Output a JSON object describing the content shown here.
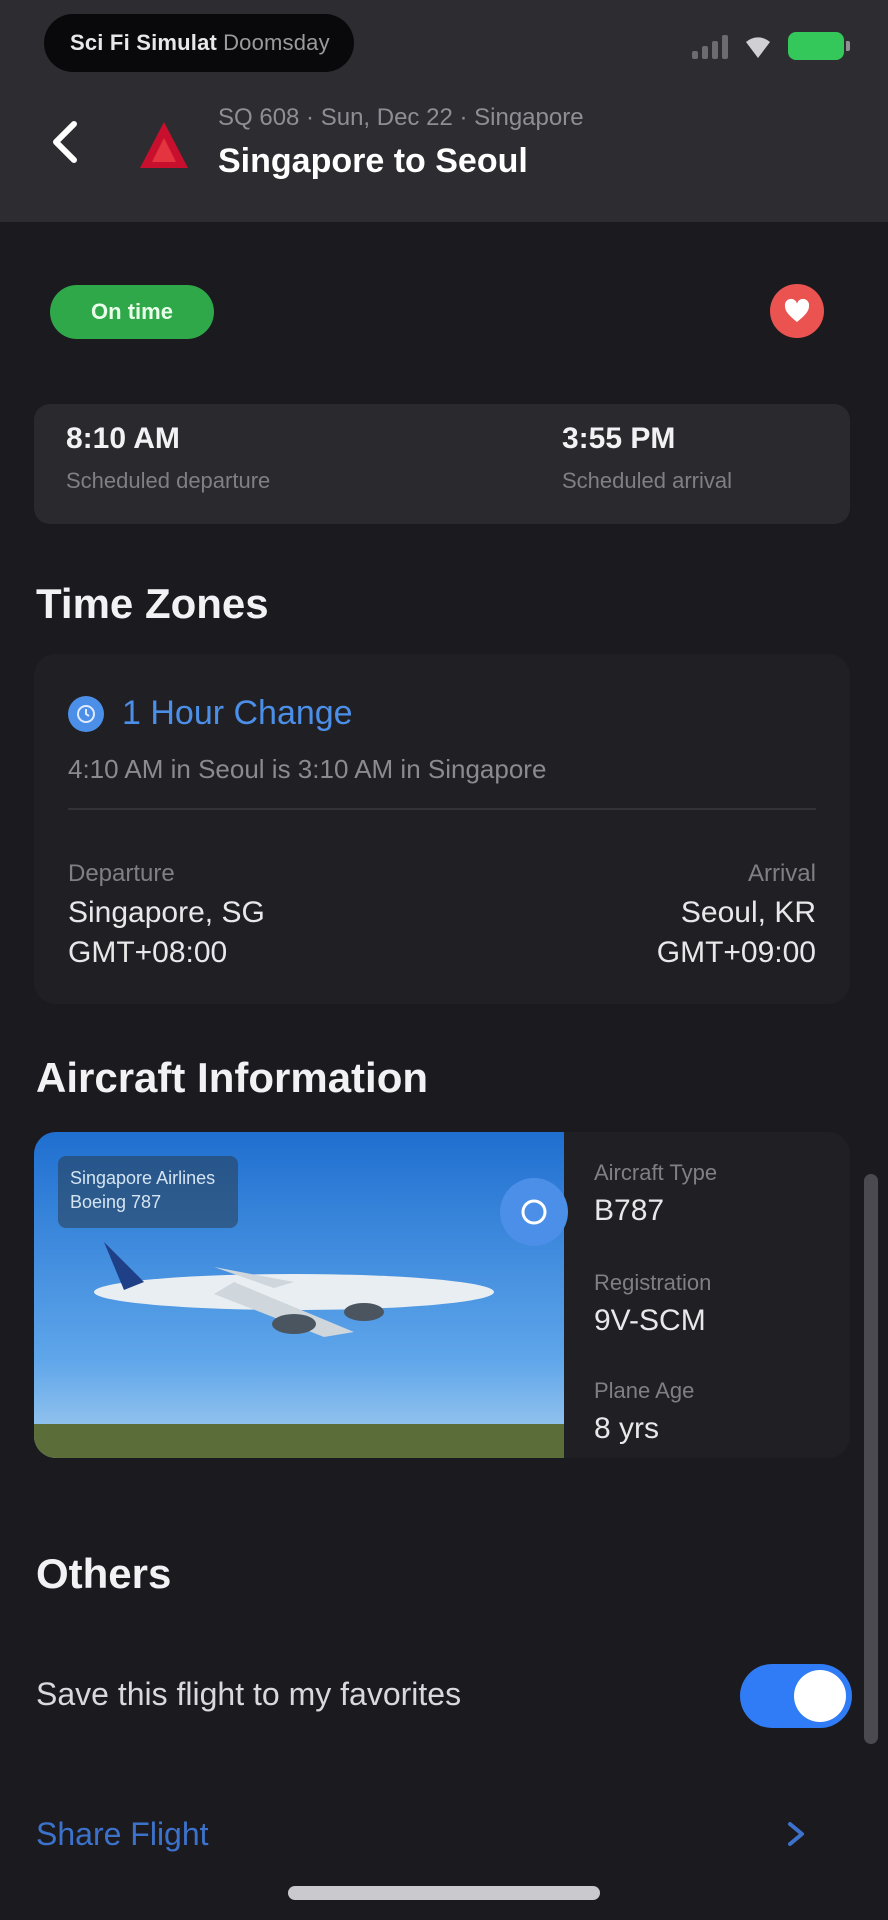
{
  "status_bar": {
    "notification": "Sci Fi Simulat",
    "notification_sub": "Doomsday",
    "icons": [
      "signal-icon",
      "wifi-icon",
      "battery-icon"
    ]
  },
  "header": {
    "subtitle": "SQ 608 · Sun, Dec 22 · Singapore",
    "title": "Singapore to Seoul",
    "logo_color": "#c8102e"
  },
  "flight_status": {
    "badge": "On time",
    "badge_color": "#2fa84a",
    "heart_color": "#ea5350"
  },
  "times": {
    "left": {
      "value": "8:10 AM",
      "label": "Scheduled departure"
    },
    "right": {
      "value": "3:55 PM",
      "label": "Scheduled arrival"
    }
  },
  "time_zones": {
    "title": "Time Zones",
    "change": "1 Hour Change",
    "description": "4:10 AM in Seoul is 3:10 AM in Singapore",
    "departure": {
      "label": "Departure",
      "city": "Singapore, SG",
      "offset": "GMT+08:00"
    },
    "arrival": {
      "label": "Arrival",
      "city": "Seoul, KR",
      "offset": "GMT+09:00"
    }
  },
  "aircraft": {
    "title": "Aircraft Information",
    "photo_tag_line1": "Singapore Airlines",
    "photo_tag_line2": "Boeing 787",
    "type": {
      "label": "Aircraft Type",
      "value": "B787"
    },
    "registration": {
      "label": "Registration",
      "value": "9V-SCM"
    },
    "age": {
      "label": "Plane Age",
      "value": "8 yrs"
    }
  },
  "others": {
    "title": "Others",
    "favorite_label": "Save this flight to my favorites",
    "favorite_on": true,
    "share_label": "Share Flight"
  },
  "colors": {
    "accent": "#4c8fe8",
    "toggle": "#2f7cf6",
    "background": "#1b1a1f"
  }
}
